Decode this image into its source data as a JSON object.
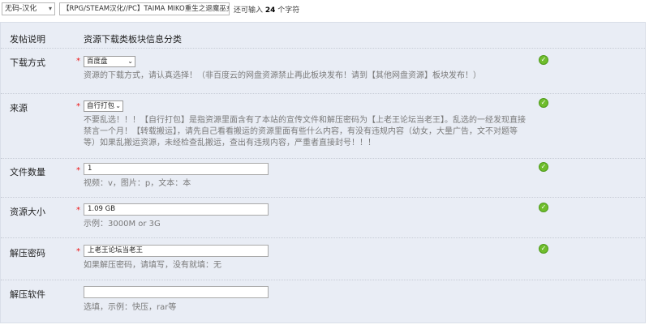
{
  "topbar": {
    "category_value": "无码-汉化",
    "title_value": "【RPG/STEAM汉化//PC】TAIMA MIKO重生之退魔巫女",
    "remain_prefix": "还可输入",
    "remain_count": "24",
    "remain_suffix": "个字符"
  },
  "header": {
    "label": "发帖说明",
    "text": "资源下载类板块信息分类"
  },
  "fields": {
    "download": {
      "label": "下载方式",
      "required": "*",
      "value": "百度盘",
      "help": "资源的下载方式，请认真选择！（非百度云的网盘资源禁止再此板块发布！请到【其他网盘资源】板块发布！）"
    },
    "source": {
      "label": "来源",
      "required": "*",
      "value": "自行打包",
      "help": "不要乱选！！！【自行打包】是指资源里面含有了本站的宣传文件和解压密码为【上老王论坛当老王】。乱选的一经发现直接禁言一个月！【转载搬运】，请先自己看看搬运的资源里面有些什么内容，有没有违规内容（幼女，大量广告，文不对题等等）如果乱搬运资源，未经检查乱搬运，查出有违规内容，严重者直接封号！！！"
    },
    "count": {
      "label": "文件数量",
      "required": "*",
      "value": "1",
      "help": "视频：v，图片：p，文本：本"
    },
    "size": {
      "label": "资源大小",
      "required": "*",
      "value": "1.09 GB",
      "help": "示例：3000M or 3G"
    },
    "password": {
      "label": "解压密码",
      "required": "*",
      "value": "上老王论坛当老王",
      "help": "如果解压密码，请填写，没有就填：无"
    },
    "software": {
      "label": "解压软件",
      "value": "",
      "help": "选填，示例：快压，rar等"
    }
  },
  "icons": {
    "ok": "check-circle-icon",
    "ok_color": "#6fbd2c",
    "required_color": "#e11111"
  }
}
